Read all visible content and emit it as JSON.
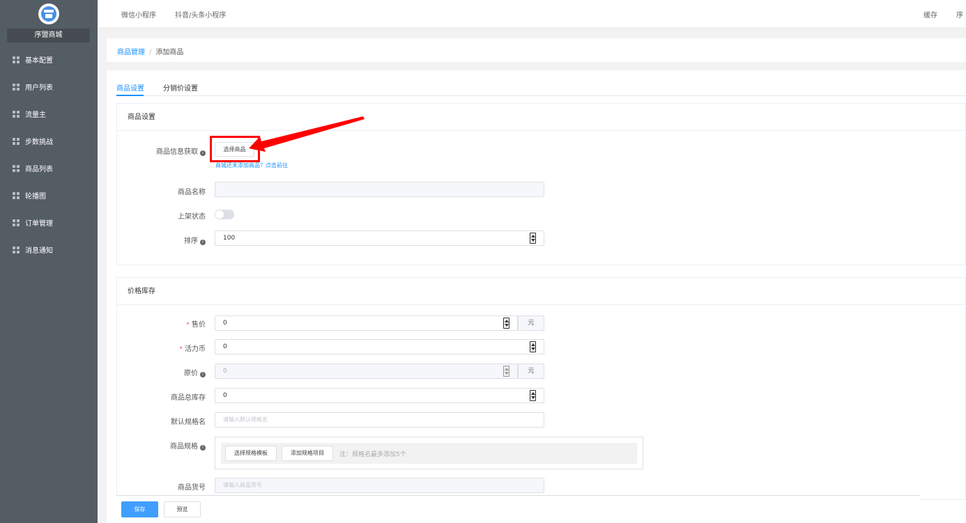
{
  "sidebar": {
    "brand": "序盟商城",
    "items": [
      {
        "label": "基本配置"
      },
      {
        "label": "用户列表"
      },
      {
        "label": "流量主"
      },
      {
        "label": "步数挑战"
      },
      {
        "label": "商品列表"
      },
      {
        "label": "轮播图"
      },
      {
        "label": "订单管理"
      },
      {
        "label": "消息通知"
      }
    ]
  },
  "topbar": {
    "tabs": [
      "微信小程序",
      "抖音/头条小程序"
    ],
    "right": [
      "缓存",
      "序"
    ]
  },
  "breadcrumb": {
    "parent": "商品管理",
    "separator": "/",
    "current": "添加商品"
  },
  "tabs": {
    "active": "商品设置",
    "other": "分销价设置"
  },
  "goods_settings": {
    "title": "商品设置",
    "fetch_label": "商品信息获取",
    "select_button": "选择商品",
    "helper": "商城还未添加商品？点击前往",
    "name_label": "商品名称",
    "name_value": "",
    "status_label": "上架状态",
    "sort_label": "排序",
    "sort_value": "100"
  },
  "price_stock": {
    "title": "价格库存",
    "price_label": "售价",
    "price_value": "0",
    "unit": "元",
    "coin_label": "活力币",
    "coin_value": "0",
    "original_label": "原价",
    "original_value": "0",
    "stock_label": "商品总库存",
    "stock_value": "0",
    "default_spec_label": "默认规格名",
    "default_spec_placeholder": "请输入默认规格名",
    "spec_label": "商品规格",
    "select_template_button": "选择规格模板",
    "add_spec_button": "添加规格项目",
    "spec_note": "注：规格名最多添加5个",
    "sku_label": "商品货号",
    "sku_placeholder": "请输入商品货号"
  },
  "footer": {
    "save": "保存",
    "preview": "预览"
  },
  "colors": {
    "sidebar": "#545c64",
    "primary": "#409eff",
    "annotation": "#ff0000"
  }
}
